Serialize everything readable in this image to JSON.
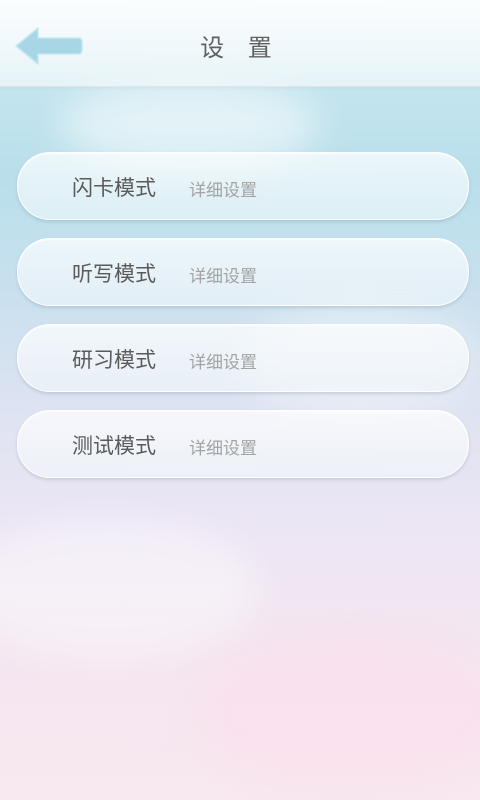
{
  "header": {
    "title": "设 置",
    "back_icon": "arrow-left-icon",
    "back_icon_color": "#a9d6e6"
  },
  "menu": {
    "items": [
      {
        "mode": "闪卡模式",
        "detail": "详细设置"
      },
      {
        "mode": "听写模式",
        "detail": "详细设置"
      },
      {
        "mode": "研习模式",
        "detail": "详细设置"
      },
      {
        "mode": "测试模式",
        "detail": "详细设置"
      }
    ]
  }
}
